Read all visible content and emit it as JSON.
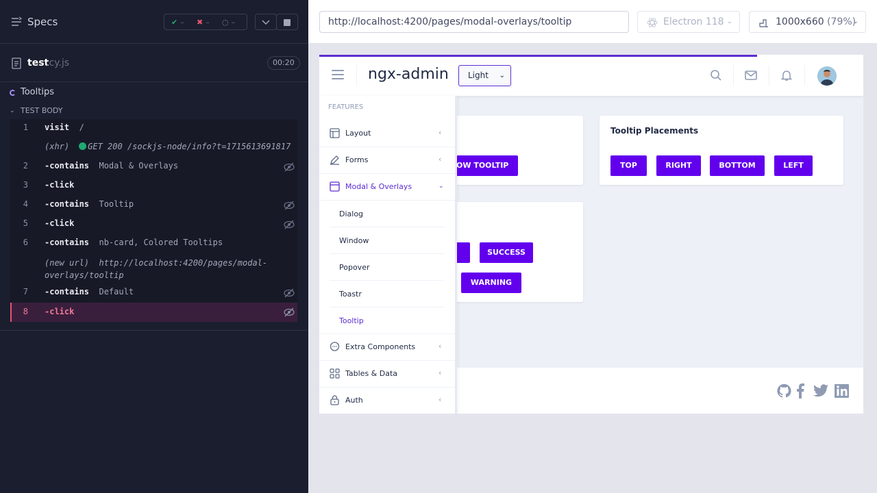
{
  "runner": {
    "specs_label": "Specs",
    "stats": {
      "passed": "–",
      "failed": "–",
      "pending": "–"
    },
    "spec_file": {
      "name": "test",
      "ext": ".cy.js",
      "duration": "00:20"
    },
    "suite_title": "Tooltips",
    "test_body_label": "TEST BODY",
    "commands": [
      {
        "num": "1",
        "name": "visit",
        "arg": "/"
      },
      {
        "num": "",
        "name": "(xhr)",
        "arg": "GET 200 /sockjs-node/info?t=1715613691817"
      },
      {
        "num": "2",
        "name": "-contains",
        "arg": "Modal & Overlays"
      },
      {
        "num": "3",
        "name": "-click",
        "arg": ""
      },
      {
        "num": "4",
        "name": "-contains",
        "arg": "Tooltip"
      },
      {
        "num": "5",
        "name": "-click",
        "arg": ""
      },
      {
        "num": "6",
        "name": "-contains",
        "arg": "nb-card, Colored Tooltips"
      },
      {
        "num": "",
        "name": "(new url)",
        "arg": "http://localhost:4200/pages/modal-",
        "arg2": "overlays/tooltip"
      },
      {
        "num": "7",
        "name": "-contains",
        "arg": "Default"
      },
      {
        "num": "8",
        "name": "-click",
        "arg": ""
      }
    ]
  },
  "browser": {
    "url": "http://localhost:4200/pages/modal-overlays/tooltip",
    "browser_name": "Electron 118",
    "viewport": "1000x660",
    "scale": "(79%)"
  },
  "app": {
    "brand": "ngx-admin",
    "theme": "Light",
    "cards": {
      "tooltip_with_icon_button": "OW TOOLTIP",
      "placements_title": "Tooltip Placements",
      "placements": [
        "TOP",
        "RIGHT",
        "BOTTOM",
        "LEFT"
      ],
      "colored_buttons": [
        "SUCCESS",
        "WARNING"
      ]
    },
    "sidebar": {
      "header": "FEATURES",
      "items": [
        {
          "label": "Layout",
          "icon": "layout-icon"
        },
        {
          "label": "Forms",
          "icon": "edit-icon"
        },
        {
          "label": "Modal & Overlays",
          "icon": "browser-icon"
        },
        {
          "label": "Extra Components",
          "icon": "message-icon"
        },
        {
          "label": "Tables & Data",
          "icon": "grid-icon"
        },
        {
          "label": "Auth",
          "icon": "lock-icon"
        }
      ],
      "subitems": [
        "Dialog",
        "Window",
        "Popover",
        "Toastr",
        "Tooltip"
      ]
    },
    "colors": {
      "primary": "#6200ee",
      "accent": "#5c2dd1"
    }
  }
}
